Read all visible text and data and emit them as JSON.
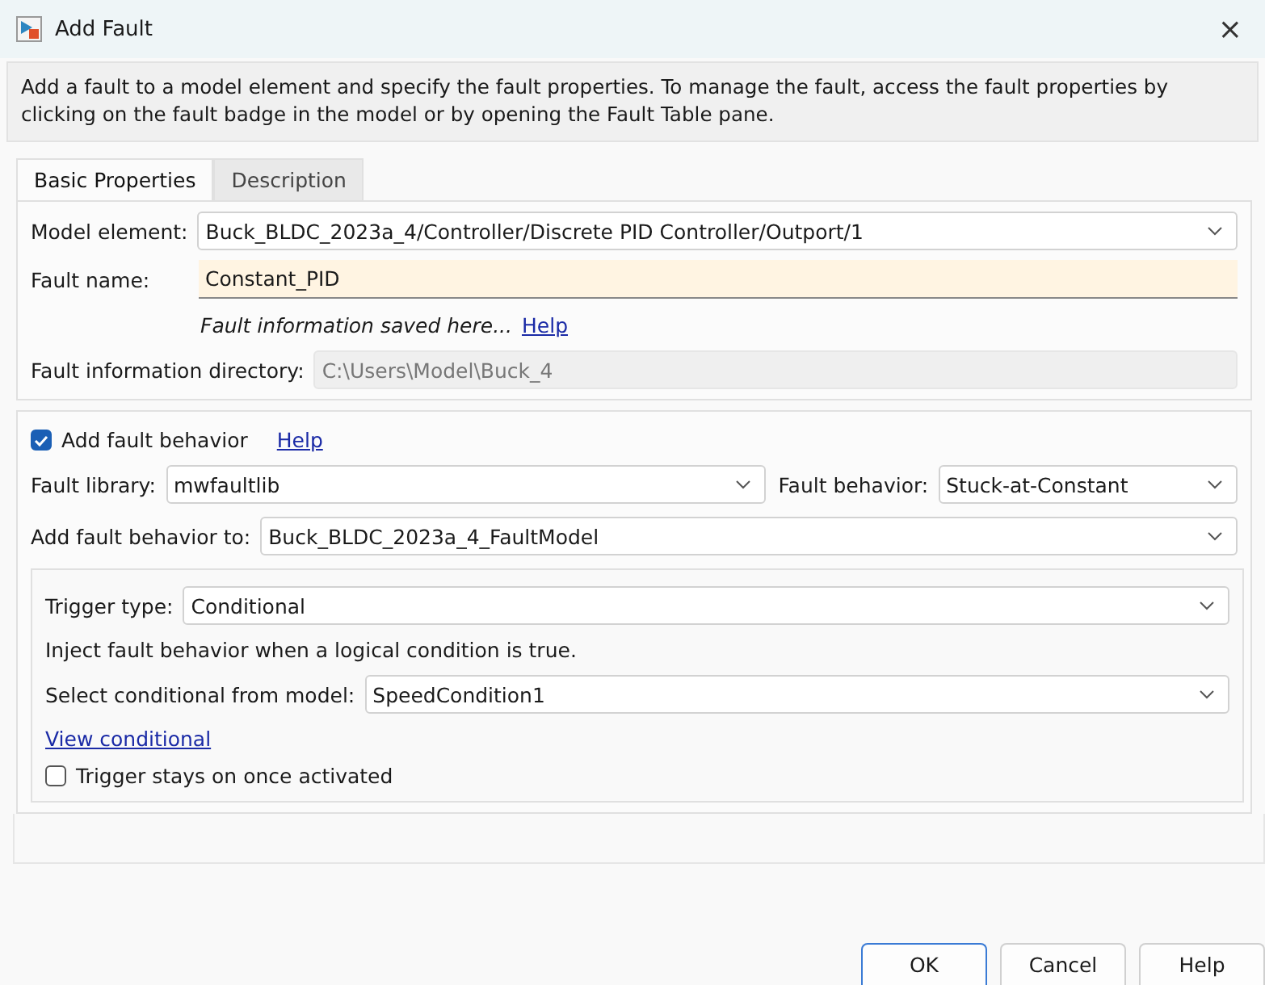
{
  "window": {
    "title": "Add Fault",
    "close": "×"
  },
  "description": "Add a fault to a model element and specify the fault properties. To manage the fault, access the fault properties by clicking on the fault badge in the model or by opening the Fault Table pane.",
  "tabs": [
    {
      "label": "Basic Properties",
      "selected": true
    },
    {
      "label": "Description",
      "selected": false
    }
  ],
  "model_element": {
    "label": "Model element:",
    "value": "Buck_BLDC_2023a_4/Controller/Discrete PID Controller/Outport/1"
  },
  "fault_name": {
    "label": "Fault name:",
    "value": "Constant_PID"
  },
  "save_note": {
    "text": "Fault information saved here...",
    "link": "Help"
  },
  "fault_directory": {
    "label": "Fault information directory:",
    "value": "C:\\Users\\Model\\Buck_4",
    "disabled": true
  },
  "add_behavior": {
    "label": "Add fault behavior",
    "checked": true,
    "link": "Help"
  },
  "fault_library": {
    "label": "Fault library:",
    "value": "mwfaultlib"
  },
  "fault_behavior": {
    "label": "Fault behavior:",
    "value": "Stuck-at-Constant"
  },
  "add_behavior_to": {
    "label": "Add fault behavior to:",
    "value": "Buck_BLDC_2023a_4_FaultModel"
  },
  "trigger": {
    "type": {
      "label": "Trigger type:",
      "value": "Conditional"
    },
    "hint": "Inject fault behavior when a logical condition is true.",
    "conditional": {
      "label": "Select conditional from model:",
      "value": "SpeedCondition1"
    },
    "view_link": "View conditional",
    "stays_on": {
      "label": "Trigger stays on once activated",
      "checked": false
    }
  },
  "buttons": [
    {
      "label": "OK",
      "default": true
    },
    {
      "label": "Cancel",
      "default": false
    },
    {
      "label": "Help",
      "default": false
    }
  ]
}
